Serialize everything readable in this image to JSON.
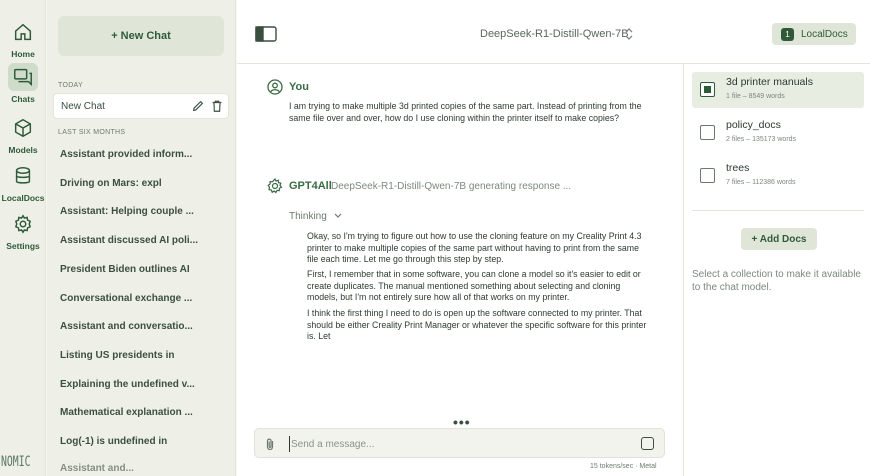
{
  "rail": {
    "items": [
      {
        "label": "Home",
        "icon": "home-icon"
      },
      {
        "label": "Chats",
        "icon": "chat-icon"
      },
      {
        "label": "Models",
        "icon": "cube-icon"
      },
      {
        "label": "LocalDocs",
        "icon": "database-icon"
      },
      {
        "label": "Settings",
        "icon": "gear-icon"
      }
    ],
    "brand": "NOMIC"
  },
  "chatlist": {
    "new_chat_label": "+ New Chat",
    "today_label": "TODAY",
    "active_chat": "New Chat",
    "older_label": "LAST SIX MONTHS",
    "chats": [
      "Assistant provided inform...",
      "Driving on Mars: expl",
      "Assistant: Helping couple ...",
      "Assistant discussed AI poli...",
      "President Biden outlines AI",
      "Conversational exchange ...",
      "Assistant and conversatio...",
      "Listing US presidents in",
      "Explaining the undefined v...",
      "Mathematical explanation ...",
      "Log(-1) is undefined in",
      "Assistant and..."
    ]
  },
  "topbar": {
    "model": "DeepSeek-R1-Distill-Qwen-7B",
    "localdocs_count": "1",
    "localdocs_label": "LocalDocs"
  },
  "conversation": {
    "user": {
      "author": "You",
      "text": "I am trying to make multiple 3d printed copies of the same part. Instead of printing from the same file over and over, how do I use cloning within the printer itself to make copies?"
    },
    "assistant": {
      "author": "GPT4All",
      "status": "DeepSeek-R1-Distill-Qwen-7B generating response ...",
      "thinking_label": "Thinking",
      "paragraphs": [
        "Okay, so I'm trying to figure out how to use the cloning feature on my Creality Print 4.3 printer to make multiple copies of the same part without having to print from the same file each time. Let me go through this step by step.",
        "First, I remember that in some software, you can clone a model so it's easier to edit or create duplicates. The manual mentioned something about selecting and cloning models, but I'm not entirely sure how all of that works on my printer.",
        "I think the first thing I need to do is open up the software connected to my printer. That should be either Creality Print Manager or whatever the specific software for this printer is. Let"
      ]
    }
  },
  "input": {
    "placeholder": "Send a message...",
    "tokens_status": "15 tokens/sec · Metal"
  },
  "collections": {
    "items": [
      {
        "name": "3d printer manuals",
        "meta": "1 file – 8549 words",
        "checked": true
      },
      {
        "name": "policy_docs",
        "meta": "2 files – 135173 words",
        "checked": false
      },
      {
        "name": "trees",
        "meta": "7 files – 112386 words",
        "checked": false
      }
    ],
    "add_label": "+ Add Docs",
    "hint": "Select a collection to make it available to the chat model."
  },
  "colors": {
    "accent": "#2f5a3a",
    "accent_soft": "#dfe6d8",
    "background": "#f7f8f3"
  }
}
